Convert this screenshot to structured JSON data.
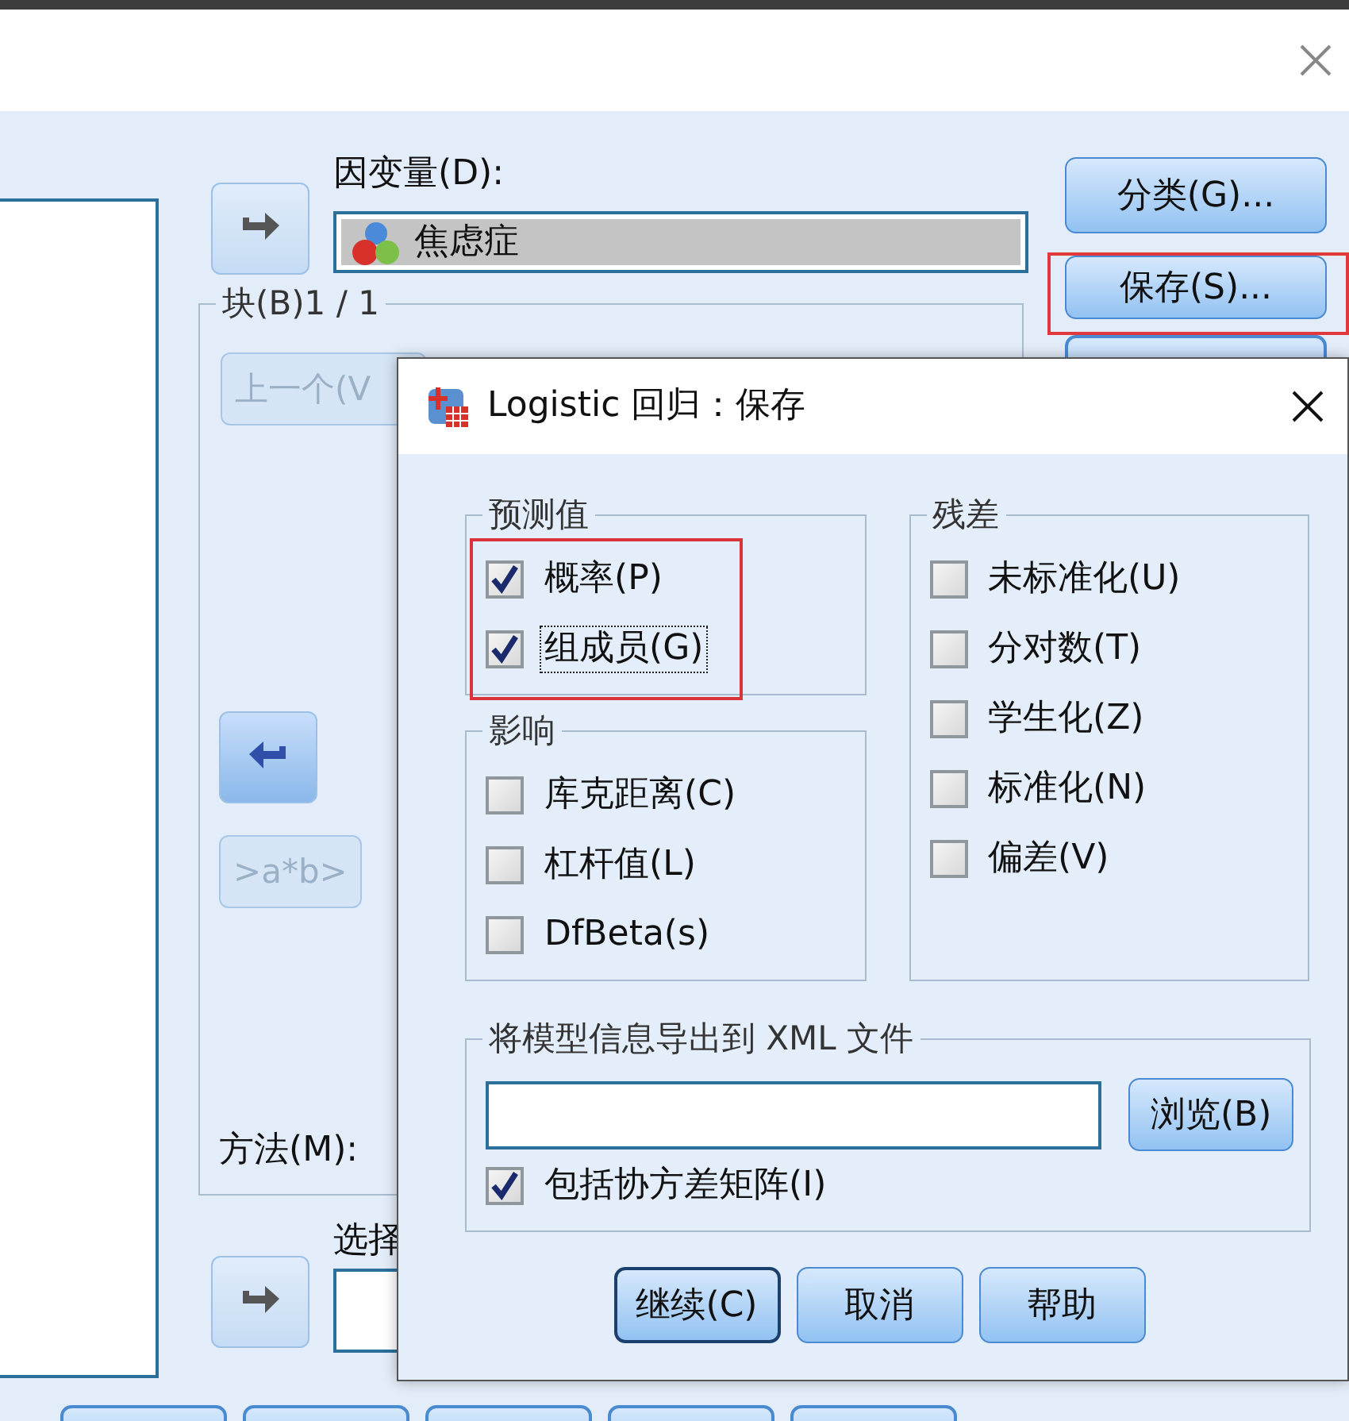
{
  "main_dialog": {
    "dependent_label": "因变量(D):",
    "dependent_variable": "焦虑症",
    "block_label": "块(B)1 / 1",
    "previous_button": "上一个(V",
    "interaction_button": ">a*b>",
    "method_label": "方法(M):",
    "selection_label": "选择",
    "side_buttons": [
      {
        "label": "分类(G)...",
        "highlighted": false
      },
      {
        "label": "保存(S)...",
        "highlighted": true
      }
    ]
  },
  "save_dialog": {
    "title": "Logistic 回归：保存",
    "groups": [
      {
        "title": "预测值",
        "highlighted": true,
        "items": [
          {
            "label": "概率(P)",
            "checked": true,
            "focused": false
          },
          {
            "label": "组成员(G)",
            "checked": true,
            "focused": true
          }
        ]
      },
      {
        "title": "影响",
        "highlighted": false,
        "items": [
          {
            "label": "库克距离(C)",
            "checked": false,
            "focused": false
          },
          {
            "label": "杠杆值(L)",
            "checked": false,
            "focused": false
          },
          {
            "label": "DfBeta(s)",
            "checked": false,
            "focused": false
          }
        ]
      },
      {
        "title": "残差",
        "highlighted": false,
        "items": [
          {
            "label": "未标准化(U)",
            "checked": false,
            "focused": false
          },
          {
            "label": "分对数(T)",
            "checked": false,
            "focused": false
          },
          {
            "label": "学生化(Z)",
            "checked": false,
            "focused": false
          },
          {
            "label": "标准化(N)",
            "checked": false,
            "focused": false
          },
          {
            "label": "偏差(V)",
            "checked": false,
            "focused": false
          }
        ]
      }
    ],
    "export": {
      "title": "将模型信息导出到 XML 文件",
      "browse_button": "浏览(B)",
      "include_covariance": {
        "label": "包括协方差矩阵(I)",
        "checked": true
      }
    },
    "buttons": [
      {
        "label": "继续(C)",
        "default": true
      },
      {
        "label": "取消",
        "default": false
      },
      {
        "label": "帮助",
        "default": false
      }
    ]
  }
}
